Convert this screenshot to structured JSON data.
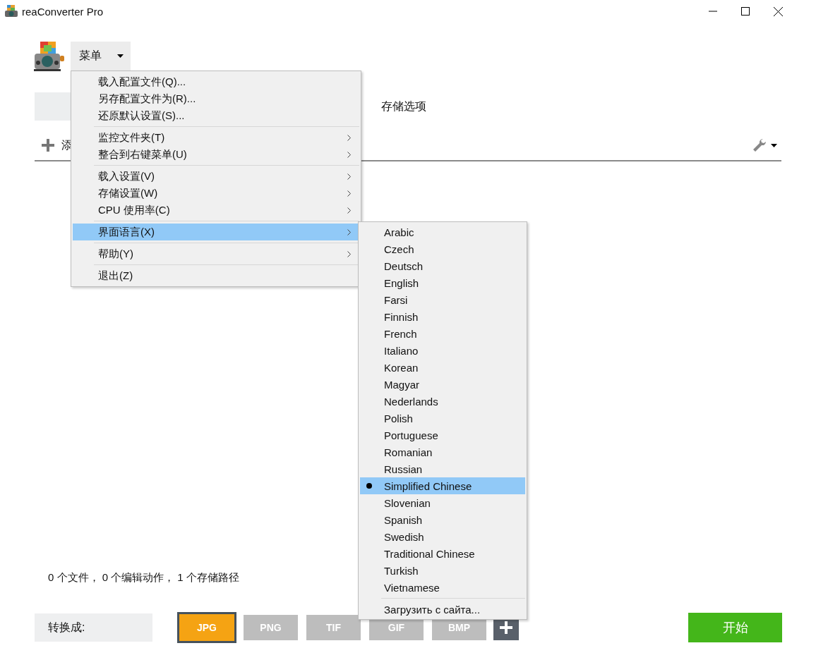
{
  "window": {
    "title": "reaConverter Pro"
  },
  "menu_button": {
    "label": "菜单"
  },
  "tabs": [
    {
      "selected": true
    },
    {
      "label": "存储选项",
      "selected": false
    }
  ],
  "toolbar": {
    "add_label": "添"
  },
  "main_menu": [
    {
      "kind": "item",
      "label": "载入配置文件(Q)...",
      "submenu": false,
      "highlighted": false
    },
    {
      "kind": "item",
      "label": "另存配置文件为(R)...",
      "submenu": false,
      "highlighted": false
    },
    {
      "kind": "item",
      "label": "还原默认设置(S)...",
      "submenu": false,
      "highlighted": false
    },
    {
      "kind": "separator"
    },
    {
      "kind": "item",
      "label": "监控文件夹(T)",
      "submenu": true,
      "highlighted": false
    },
    {
      "kind": "item",
      "label": "整合到右键菜单(U)",
      "submenu": true,
      "highlighted": false
    },
    {
      "kind": "separator"
    },
    {
      "kind": "item",
      "label": "载入设置(V)",
      "submenu": true,
      "highlighted": false
    },
    {
      "kind": "item",
      "label": "存储设置(W)",
      "submenu": true,
      "highlighted": false
    },
    {
      "kind": "item",
      "label": "CPU 使用率(C)",
      "submenu": true,
      "highlighted": false
    },
    {
      "kind": "separator"
    },
    {
      "kind": "item",
      "label": "界面语言(X)",
      "submenu": true,
      "highlighted": true
    },
    {
      "kind": "separator"
    },
    {
      "kind": "item",
      "label": "帮助(Y)",
      "submenu": true,
      "highlighted": false
    },
    {
      "kind": "separator"
    },
    {
      "kind": "item",
      "label": "退出(Z)",
      "submenu": false,
      "highlighted": false
    }
  ],
  "language_menu": [
    {
      "kind": "item",
      "label": "Arabic",
      "selected": false
    },
    {
      "kind": "item",
      "label": "Czech",
      "selected": false
    },
    {
      "kind": "item",
      "label": "Deutsch",
      "selected": false
    },
    {
      "kind": "item",
      "label": "English",
      "selected": false
    },
    {
      "kind": "item",
      "label": "Farsi",
      "selected": false
    },
    {
      "kind": "item",
      "label": "Finnish",
      "selected": false
    },
    {
      "kind": "item",
      "label": "French",
      "selected": false
    },
    {
      "kind": "item",
      "label": "Italiano",
      "selected": false
    },
    {
      "kind": "item",
      "label": "Korean",
      "selected": false
    },
    {
      "kind": "item",
      "label": "Magyar",
      "selected": false
    },
    {
      "kind": "item",
      "label": "Nederlands",
      "selected": false
    },
    {
      "kind": "item",
      "label": "Polish",
      "selected": false
    },
    {
      "kind": "item",
      "label": "Portuguese",
      "selected": false
    },
    {
      "kind": "item",
      "label": "Romanian",
      "selected": false
    },
    {
      "kind": "item",
      "label": "Russian",
      "selected": false
    },
    {
      "kind": "item",
      "label": "Simplified Chinese",
      "selected": true
    },
    {
      "kind": "item",
      "label": "Slovenian",
      "selected": false
    },
    {
      "kind": "item",
      "label": "Spanish",
      "selected": false
    },
    {
      "kind": "item",
      "label": "Swedish",
      "selected": false
    },
    {
      "kind": "item",
      "label": "Traditional Chinese",
      "selected": false
    },
    {
      "kind": "item",
      "label": "Turkish",
      "selected": false
    },
    {
      "kind": "item",
      "label": "Vietnamese",
      "selected": false
    },
    {
      "kind": "separator"
    },
    {
      "kind": "item",
      "label": "Загрузить с сайта...",
      "selected": false
    }
  ],
  "status": "0 个文件， 0 个编辑动作， 1 个存储路径",
  "convert_label": "转换成:",
  "formats": [
    {
      "label": "JPG",
      "selected": true
    },
    {
      "label": "PNG",
      "selected": false
    },
    {
      "label": "TIF",
      "selected": false
    },
    {
      "label": "GIF",
      "selected": false
    },
    {
      "label": "BMP",
      "selected": false
    }
  ],
  "start_button": "开始"
}
